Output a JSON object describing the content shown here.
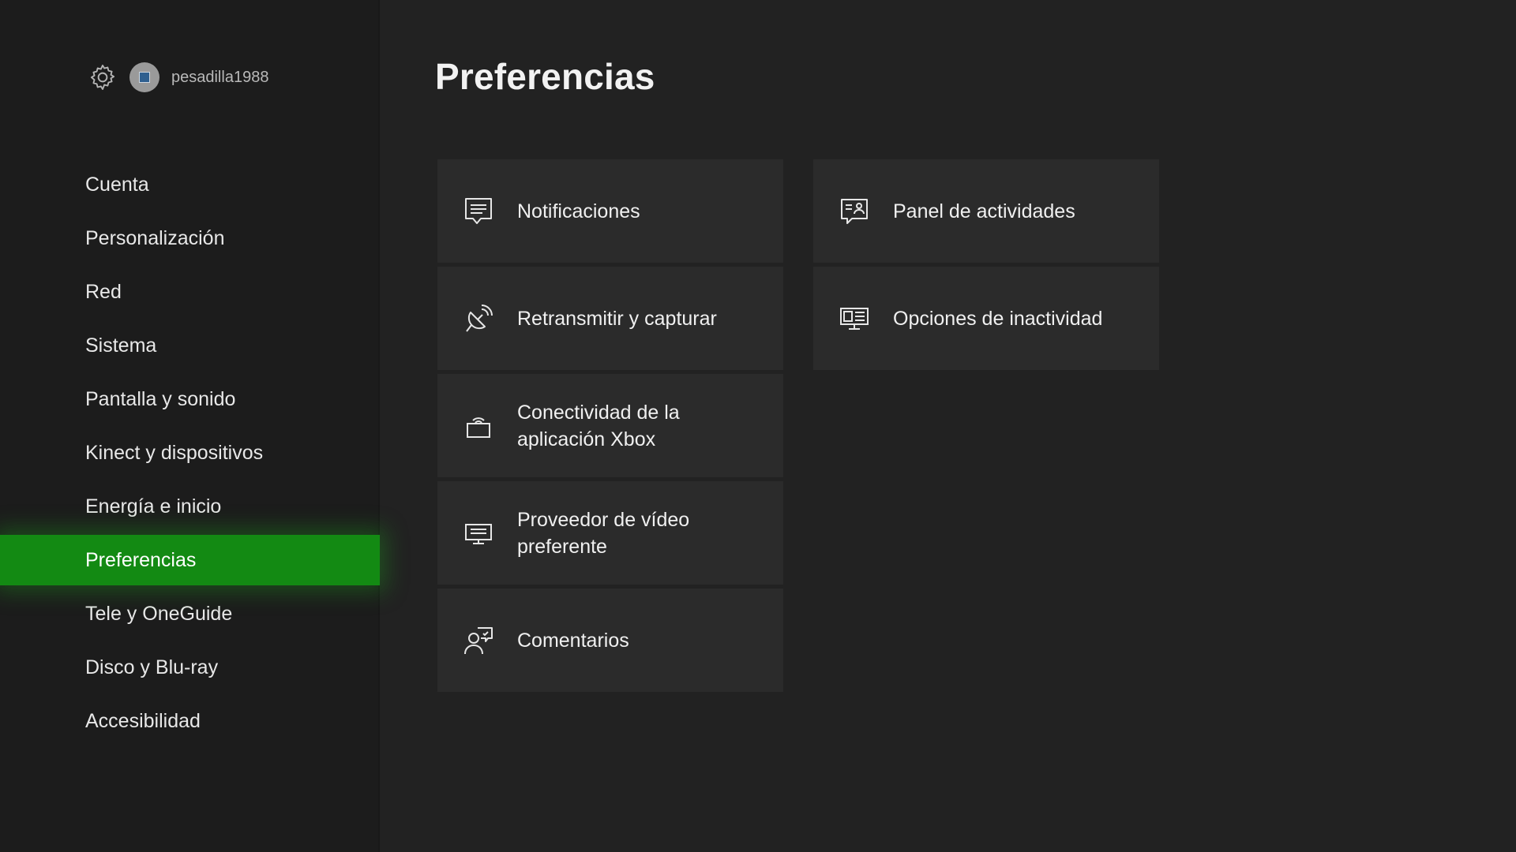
{
  "header": {
    "username": "pesadilla1988"
  },
  "sidebar": {
    "items": [
      {
        "label": "Cuenta"
      },
      {
        "label": "Personalización"
      },
      {
        "label": "Red"
      },
      {
        "label": "Sistema"
      },
      {
        "label": "Pantalla y sonido"
      },
      {
        "label": "Kinect y dispositivos"
      },
      {
        "label": "Energía e inicio"
      },
      {
        "label": "Preferencias",
        "selected": true
      },
      {
        "label": "Tele y OneGuide"
      },
      {
        "label": "Disco y Blu-ray"
      },
      {
        "label": "Accesibilidad"
      }
    ]
  },
  "main": {
    "title": "Preferencias",
    "tiles": [
      {
        "label": "Notificaciones",
        "icon": "message-icon"
      },
      {
        "label": "Retransmitir y capturar",
        "icon": "satellite-dish-icon"
      },
      {
        "label": "Conectividad de la aplicación Xbox",
        "icon": "wireless-device-icon"
      },
      {
        "label": "Proveedor de vídeo preferente",
        "icon": "tv-provider-icon"
      },
      {
        "label": "Comentarios",
        "icon": "feedback-icon"
      },
      {
        "label": "Panel de actividades",
        "icon": "activity-feed-icon"
      },
      {
        "label": "Opciones de inactividad",
        "icon": "idle-display-icon"
      }
    ]
  },
  "colors": {
    "accent": "#138a13",
    "background": "#222222",
    "sidebar": "#1c1c1c",
    "tile": "#2b2b2b"
  }
}
